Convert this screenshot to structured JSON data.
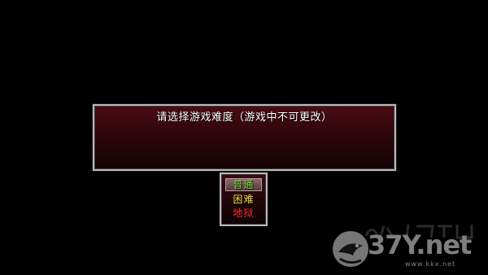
{
  "dialog": {
    "prompt": "请选择游戏难度（游戏中不可更改）"
  },
  "difficulty_menu": {
    "options": [
      {
        "label": "普通",
        "color": "#7cdc3c",
        "selected": true
      },
      {
        "label": "困难",
        "color": "#f0e040",
        "selected": false
      },
      {
        "label": "地狱",
        "color": "#ff3030",
        "selected": false
      }
    ]
  },
  "watermark": {
    "brand": "37Y.net",
    "url": "www.kkx.net",
    "icon": "bird-logo-icon"
  },
  "colors": {
    "background": "#000000",
    "window_border": "#b9b9b9",
    "window_fill_top": "#4a0c14",
    "window_fill_bottom": "#140205"
  }
}
